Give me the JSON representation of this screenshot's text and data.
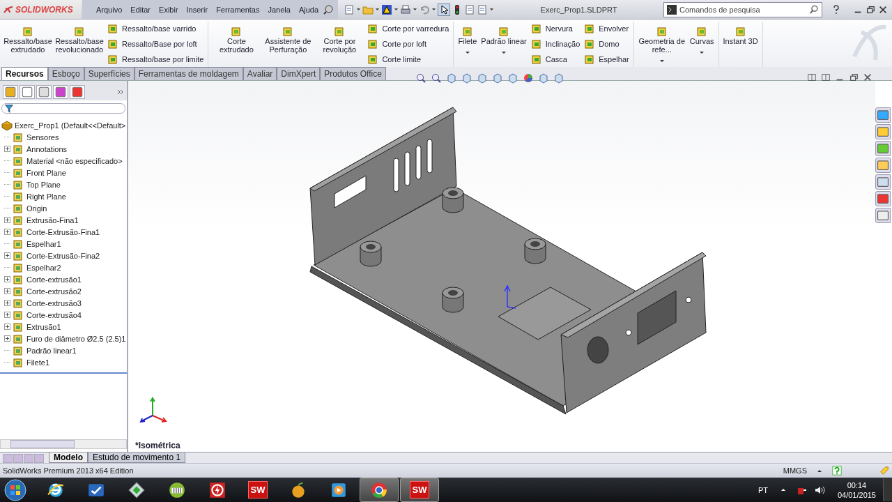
{
  "app": {
    "logo": "SOLIDWORKS",
    "menu": [
      "Arquivo",
      "Editar",
      "Exibir",
      "Inserir",
      "Ferramentas",
      "Janela",
      "Ajuda"
    ],
    "title": "Exerc_Prop1.SLDPRT",
    "search": {
      "placeholder": "Comandos de pesquisa"
    }
  },
  "ribbon": {
    "groups": [
      [
        {
          "kind": "large",
          "label": "Ressalto/base extrudado",
          "dropdown": false
        },
        {
          "kind": "large",
          "label": "Ressalto/base revolucionado",
          "dropdown": false
        },
        {
          "kind": "stack",
          "items": [
            "Ressalto/base varrido",
            "Ressalto/Base por loft",
            "Ressalto/base por limite"
          ]
        }
      ],
      [
        {
          "kind": "large",
          "label": "Corte extrudado",
          "dropdown": false
        },
        {
          "kind": "large",
          "label": "Assistente de Perfuração",
          "dropdown": false
        },
        {
          "kind": "large",
          "label": "Corte por revolução",
          "dropdown": false
        },
        {
          "kind": "stack",
          "items": [
            "Corte por varredura",
            "Corte por loft",
            "Corte limite"
          ]
        }
      ],
      [
        {
          "kind": "large",
          "label": "Filete",
          "dropdown": true
        },
        {
          "kind": "large",
          "label": "Padrão linear",
          "dropdown": true
        },
        {
          "kind": "stack",
          "items": [
            "Nervura",
            "Inclinação",
            "Casca"
          ]
        },
        {
          "kind": "stack",
          "items": [
            "Envolver",
            "Domo",
            "Espelhar"
          ]
        }
      ],
      [
        {
          "kind": "large",
          "label": "Geometria de refe...",
          "dropdown": true
        },
        {
          "kind": "large",
          "label": "Curvas",
          "dropdown": true
        }
      ],
      [
        {
          "kind": "large",
          "label": "Instant 3D",
          "dropdown": false
        }
      ]
    ]
  },
  "tabs": [
    {
      "label": "Recursos",
      "selected": true
    },
    {
      "label": "Esboço",
      "selected": false
    },
    {
      "label": "Superfícies",
      "selected": false
    },
    {
      "label": "Ferramentas de moldagem",
      "selected": false
    },
    {
      "label": "Avaliar",
      "selected": false
    },
    {
      "label": "DimXpert",
      "selected": false
    },
    {
      "label": "Produtos Office",
      "selected": false
    }
  ],
  "tree": {
    "label": "Exerc_Prop1  (Default<<Default>",
    "children": [
      {
        "label": "Sensores",
        "expandable": false
      },
      {
        "label": "Annotations",
        "expandable": true
      },
      {
        "label": "Material <não especificado>",
        "expandable": false
      },
      {
        "label": "Front Plane",
        "expandable": false
      },
      {
        "label": "Top Plane",
        "expandable": false
      },
      {
        "label": "Right Plane",
        "expandable": false
      },
      {
        "label": "Origin",
        "expandable": false
      },
      {
        "label": "Extrusão-Fina1",
        "expandable": true
      },
      {
        "label": "Corte-Extrusão-Fina1",
        "expandable": true
      },
      {
        "label": "Espelhar1",
        "expandable": false
      },
      {
        "label": "Corte-Extrusão-Fina2",
        "expandable": true
      },
      {
        "label": "Espelhar2",
        "expandable": false
      },
      {
        "label": "Corte-extrusão1",
        "expandable": true
      },
      {
        "label": "Corte-extrusão2",
        "expandable": true
      },
      {
        "label": "Corte-extrusão3",
        "expandable": true
      },
      {
        "label": "Corte-extrusão4",
        "expandable": true
      },
      {
        "label": "Extrusão1",
        "expandable": true
      },
      {
        "label": "Furo de diâmetro Ø2.5 (2.5)1",
        "expandable": true
      },
      {
        "label": "Padrão linear1",
        "expandable": false
      },
      {
        "label": "Filete1",
        "expandable": false
      }
    ]
  },
  "viewport": {
    "view": "*Isométrica"
  },
  "bottom_tabs": [
    {
      "label": "Modelo",
      "selected": true
    },
    {
      "label": "Estudo de movimento 1",
      "selected": false
    }
  ],
  "status_bar": {
    "text": "SolidWorks Premium 2013 x64 Edition",
    "units": "MMGS"
  },
  "taskbar": {
    "apps": [
      {
        "kind": "start"
      },
      {
        "kind": "ie",
        "active": false
      },
      {
        "kind": "check",
        "active": false
      },
      {
        "kind": "tile",
        "active": false
      },
      {
        "kind": "keyboard",
        "active": false
      },
      {
        "kind": "bolt",
        "active": false
      },
      {
        "kind": "sw",
        "label": "SW",
        "active": false
      },
      {
        "kind": "fruit",
        "active": false
      },
      {
        "kind": "play",
        "active": false
      },
      {
        "kind": "chrome",
        "active": true
      },
      {
        "kind": "sw",
        "label": "SW",
        "active": true
      }
    ],
    "language": "PT",
    "time": "00:14",
    "date": "04/01/2015"
  }
}
